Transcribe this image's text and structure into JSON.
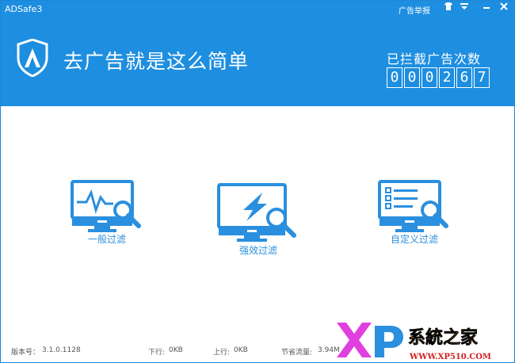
{
  "titlebar": {
    "app_name": "ADSafe3",
    "report_link": "广告举报",
    "controls": [
      "skin-icon",
      "menu-icon",
      "minimize-icon",
      "close-icon"
    ]
  },
  "header": {
    "slogan": "去广告就是这么简单",
    "counter_label": "已拦截广告次数",
    "counter_digits": [
      "0",
      "0",
      "0",
      "2",
      "6",
      "7"
    ],
    "colors": {
      "background": "#1e8ee0",
      "accent": "#2a8fde"
    }
  },
  "modes": [
    {
      "label": "一般过滤",
      "icon": "monitor-chart-search-icon"
    },
    {
      "label": "强效过滤",
      "icon": "monitor-lightning-search-icon"
    },
    {
      "label": "自定义过滤",
      "icon": "monitor-list-search-icon"
    }
  ],
  "footer": {
    "version_label": "版本号：",
    "version": "3.1.0.1128",
    "download_label": "下行:",
    "download": "0KB",
    "upload_label": "上行:",
    "upload": "0KB",
    "saved_label": "节省流量:",
    "saved": "3.94M"
  },
  "watermark": {
    "brand": "系統之家",
    "url": "WWW.XP510.COM"
  }
}
